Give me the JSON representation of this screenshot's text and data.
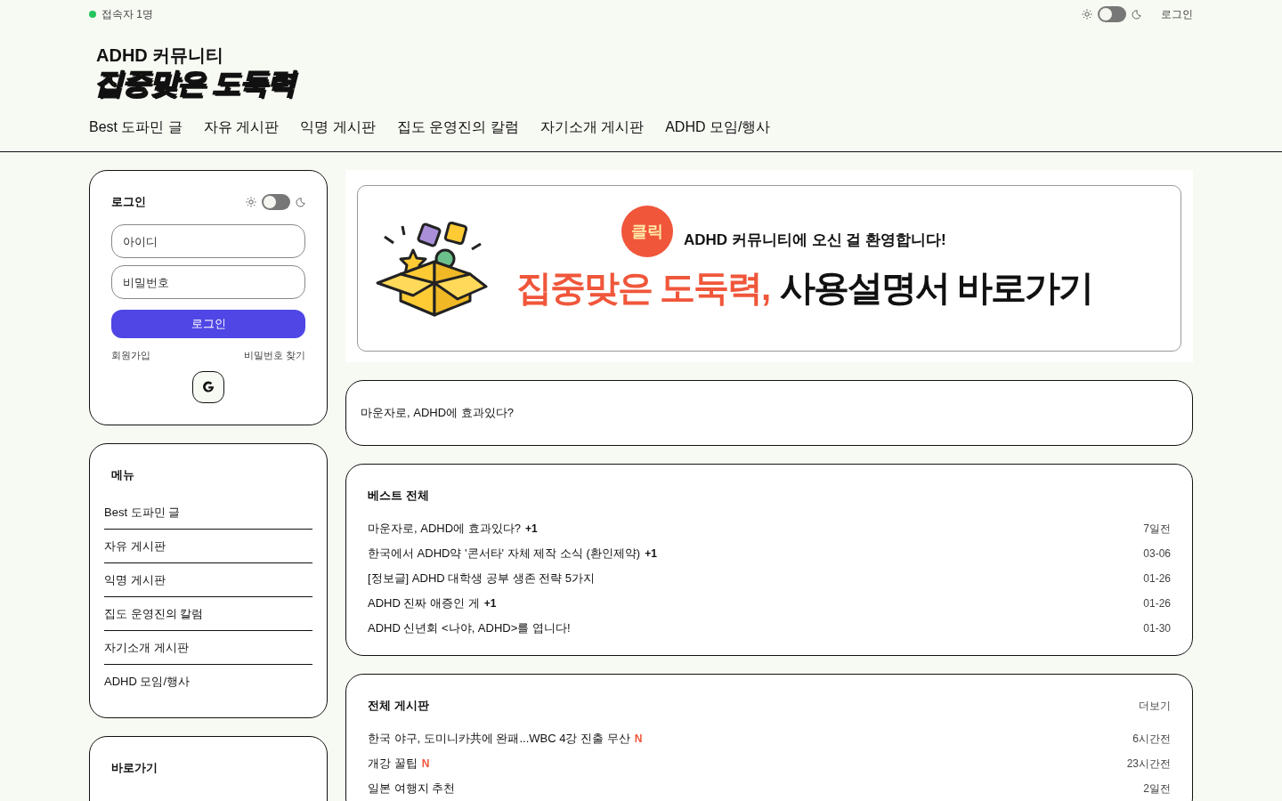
{
  "top_bar": {
    "online_count": "접속자 1명",
    "theme_dark": false,
    "login_link": "로그인"
  },
  "logo": {
    "subtitle": "ADHD 커뮤니티",
    "title": "집중맞은 도둑력"
  },
  "nav": [
    "Best 도파민 글",
    "자유 게시판",
    "익명 게시판",
    "집도 운영진의 칼럼",
    "자기소개 게시판",
    "ADHD 모임/행사"
  ],
  "login_card": {
    "title": "로그인",
    "theme_dark": false,
    "id_placeholder": "아이디",
    "password_placeholder": "비밀번호",
    "login_button": "로그인",
    "signup_link": "회원가입",
    "find_password_link": "비밀번호 찾기"
  },
  "menu_card": {
    "title": "메뉴",
    "items": [
      "Best 도파민 글",
      "자유 게시판",
      "익명 게시판",
      "집도 운영진의 칼럼",
      "자기소개 게시판",
      "ADHD 모임/행사"
    ]
  },
  "shortcut_card": {
    "title": "바로가기"
  },
  "banner": {
    "badge": "클릭",
    "tagline": "ADHD 커뮤니티에 오신 걸 환영합니다!",
    "headline_accent": "집중맞은 도둑력,",
    "headline": "사용설명서 바로가기"
  },
  "featured_post": {
    "title": "마운자로, ADHD에 효과있다?"
  },
  "best_posts": {
    "title": "베스트 전체",
    "rows": [
      {
        "title": "마운자로, ADHD에 효과있다?",
        "comments": "+1",
        "date": "7일전"
      },
      {
        "title": "한국에서 ADHD약 '콘서타' 자체 제작 소식 (환인제약)",
        "comments": "+1",
        "date": "03-06"
      },
      {
        "title": "[정보글] ADHD 대학생 공부 생존 전략 5가지",
        "date": "01-26"
      },
      {
        "title": "ADHD 진짜 애증인 게",
        "comments": "+1",
        "date": "01-26"
      },
      {
        "title": "ADHD 신년회 <나야, ADHD>를 엽니다!",
        "date": "01-30"
      }
    ]
  },
  "all_posts": {
    "title": "전체 게시판",
    "more_link": "더보기",
    "rows": [
      {
        "title": "한국 야구, 도미니카共에 완패...WBC 4강 진출 무산",
        "new_mark": "N",
        "date": "6시간전"
      },
      {
        "title": "개강 꿀팁",
        "new_mark": "N",
        "date": "23시간전"
      },
      {
        "title": "일본 여행지 추천",
        "date": "2일전"
      }
    ]
  }
}
